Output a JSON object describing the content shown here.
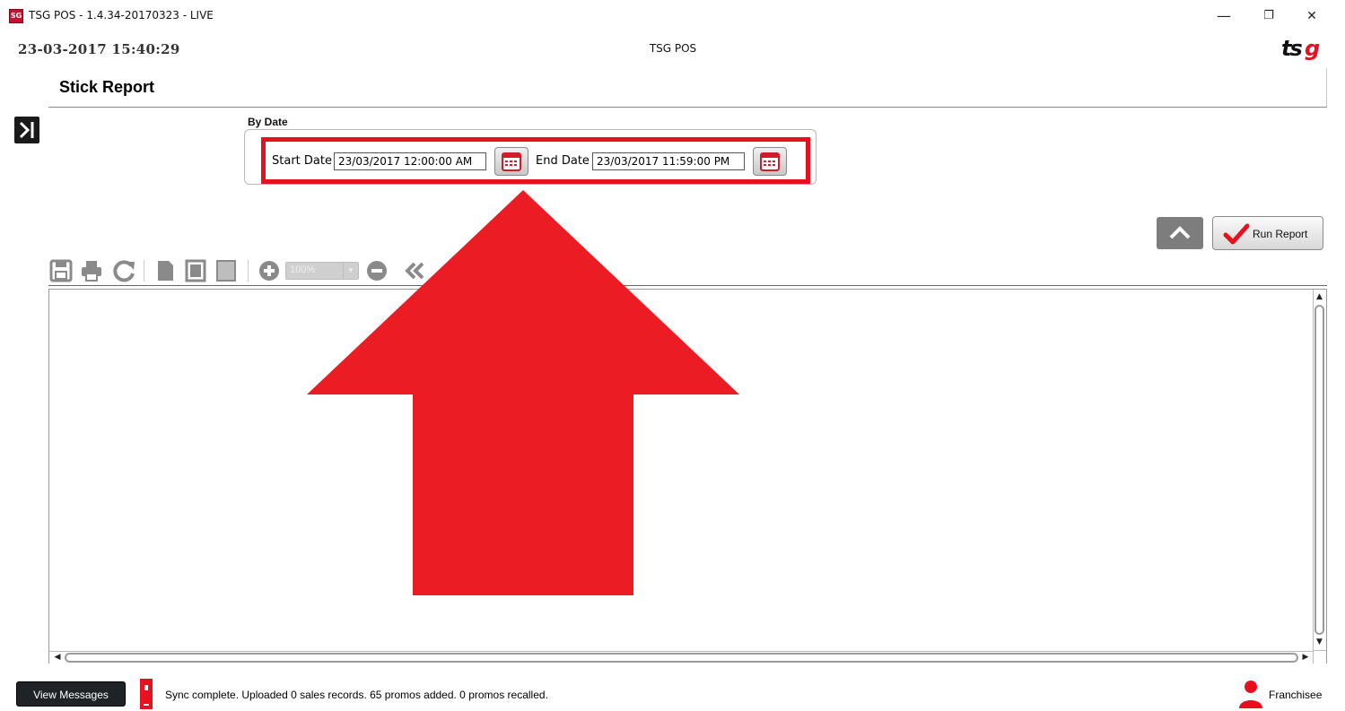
{
  "window": {
    "title": "TSG POS - 1.4.34-20170323 - LIVE",
    "app_icon_text": "SG",
    "controls": {
      "minimize": "—",
      "restore": "❐",
      "close": "✕"
    }
  },
  "header": {
    "datetime": "23-03-2017 15:40:29",
    "center_title": "TSG POS",
    "logo_text": "tsg"
  },
  "page": {
    "title": "Stick Report",
    "expand_icon": "chevron-right-bar-icon"
  },
  "filter": {
    "group_label": "By Date",
    "start_date_label": "Start Date",
    "start_date_value": "23/03/2017 12:00:00 AM",
    "end_date_label": "End Date",
    "end_date_value": "23/03/2017 11:59:00 PM",
    "calendar_icon": "calendar-icon"
  },
  "actions": {
    "collapse_icon": "chevron-up-icon",
    "run_report_label": "Run Report"
  },
  "toolbar": {
    "icons": [
      "save-icon",
      "print-icon",
      "refresh-icon",
      "page-icon",
      "page-outline-icon",
      "page-shaded-icon",
      "zoom-in-icon",
      "zoom-out-icon",
      "first-page-icon"
    ],
    "zoom_value": "100%"
  },
  "status": {
    "view_messages_label": "View Messages",
    "sync_text": "Sync complete.  Uploaded 0 sales records. 65 promos added. 0 promos recalled.",
    "user_role": "Franchisee"
  },
  "colors": {
    "accent_red": "#e8101f",
    "dark": "#1a1a1a",
    "toolbar_gray": "#7d7d7d"
  }
}
